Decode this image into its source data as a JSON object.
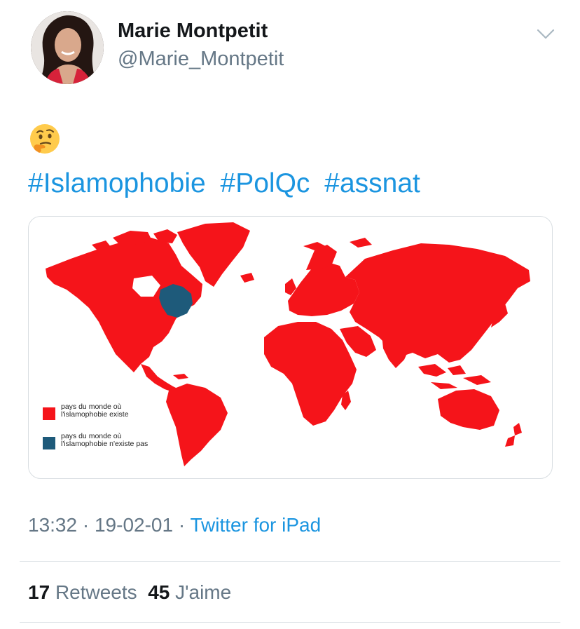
{
  "tweet": {
    "author": {
      "display_name": "Marie Montpetit",
      "handle": "@Marie_Montpetit",
      "avatar_icon": "profile-photo"
    },
    "menu_icon": "chevron-down-icon",
    "emoji": "thinking-face",
    "hashtags": [
      "#Islamophobie",
      "#PolQc",
      "#assnat"
    ],
    "media": {
      "type": "world-map",
      "legend": [
        {
          "color": "#f5141a",
          "label": "pays du monde où\nl'islamophobie existe"
        },
        {
          "color": "#1e5a7a",
          "label": "pays du monde où\nl'islamophobie n'existe pas"
        }
      ]
    },
    "timestamp": {
      "time": "13:32",
      "date": "19-02-01",
      "separator": "·",
      "source": "Twitter for iPad"
    },
    "stats": {
      "retweets_count": "17",
      "retweets_label": "Retweets",
      "likes_count": "45",
      "likes_label": "J'aime"
    }
  },
  "colors": {
    "link": "#1b95e0",
    "map_red": "#f5141a",
    "map_blue": "#1e5a7a",
    "secondary_text": "#657786"
  }
}
